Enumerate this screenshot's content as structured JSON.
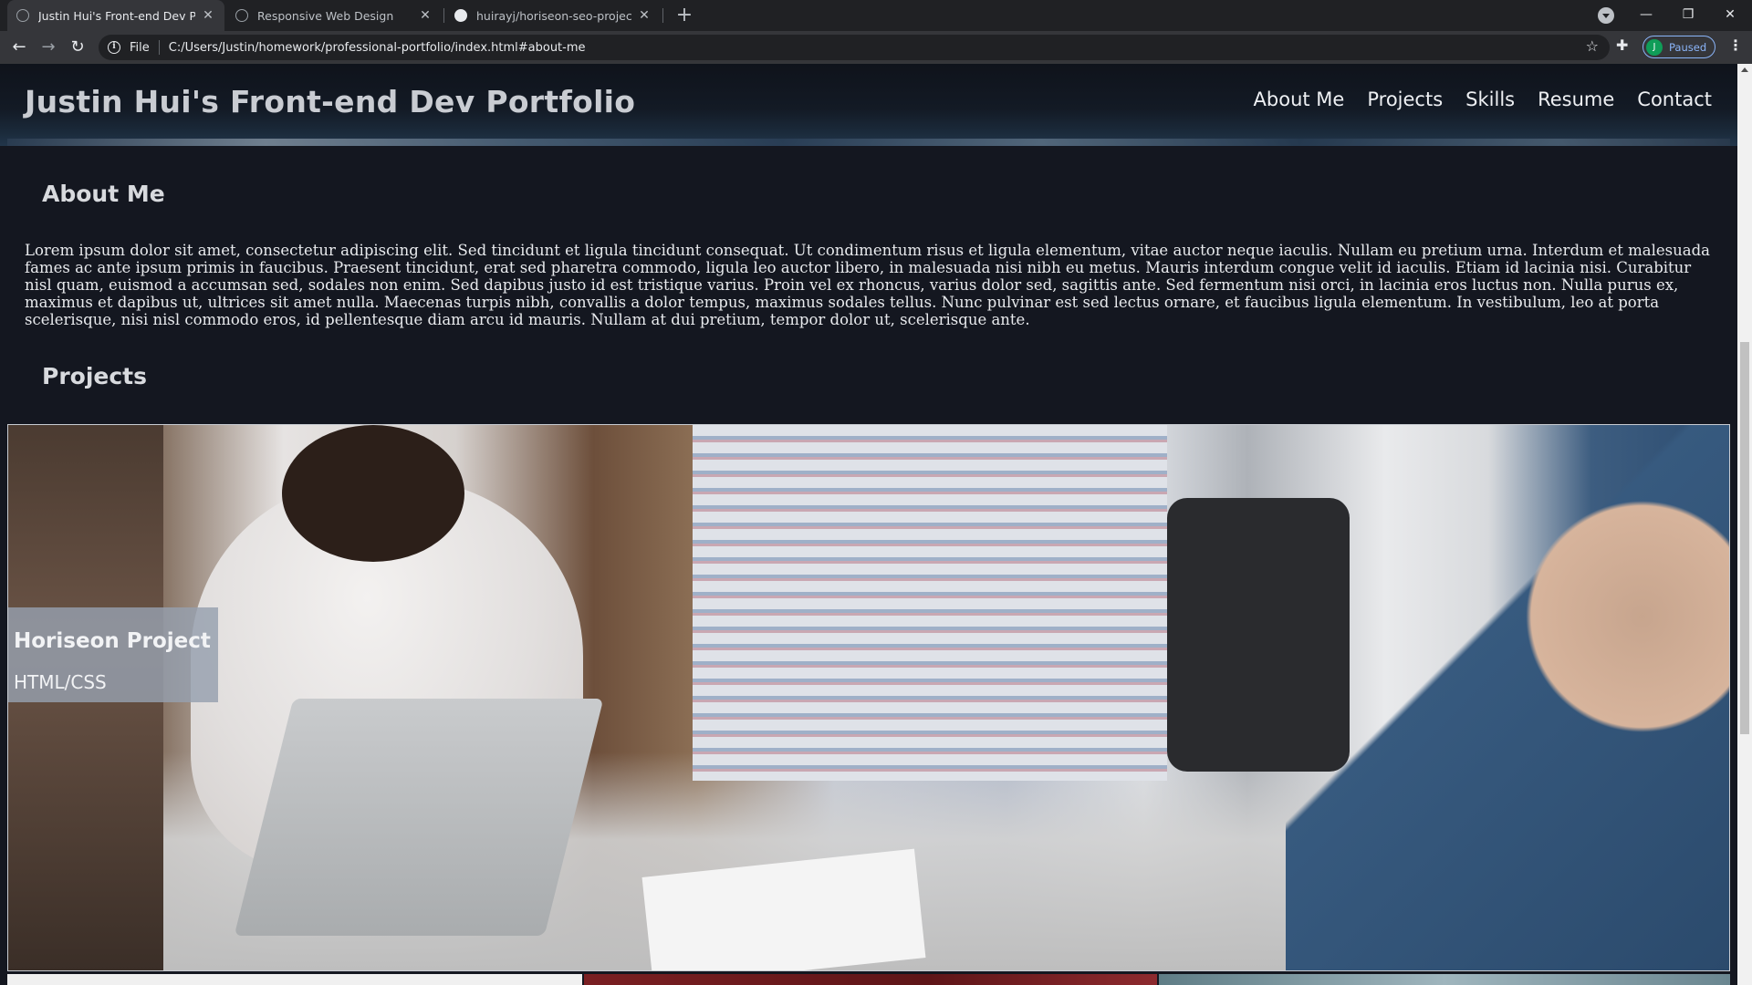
{
  "browser": {
    "tabs": [
      {
        "title": "Justin Hui's Front-end Dev Portfo",
        "active": true
      },
      {
        "title": "Responsive Web Design",
        "active": false
      },
      {
        "title": "huirayj/horiseon-seo-project: SE",
        "active": false
      }
    ],
    "address": {
      "scheme": "File",
      "url": "C:/Users/Justin/homework/professional-portfolio/index.html#about-me"
    },
    "profile": {
      "initial": "J",
      "status": "Paused"
    }
  },
  "site": {
    "title": "Justin Hui's Front-end Dev Portfolio",
    "nav": [
      "About Me",
      "Projects",
      "Skills",
      "Resume",
      "Contact"
    ]
  },
  "about": {
    "heading": "About Me",
    "text": "Lorem ipsum dolor sit amet, consectetur adipiscing elit. Sed tincidunt et ligula tincidunt consequat. Ut condimentum risus et ligula elementum, vitae auctor neque iaculis. Nullam eu pretium urna. Interdum et malesuada fames ac ante ipsum primis in faucibus. Praesent tincidunt, erat sed pharetra commodo, ligula leo auctor libero, in malesuada nisi nibh eu metus. Mauris interdum congue velit id iaculis. Etiam id lacinia nisi. Curabitur nisl quam, euismod a accumsan sed, sodales non enim. Sed dapibus justo id est tristique varius. Proin vel ex rhoncus, varius dolor sed, sagittis ante. Sed fermentum nisi orci, in lacinia eros luctus non. Nulla purus ex, maximus et dapibus ut, ultrices sit amet nulla. Maecenas turpis nibh, convallis a dolor tempus, maximus sodales tellus. Nunc pulvinar est sed lectus ornare, et faucibus ligula elementum. In vestibulum, leo at porta scelerisque, nisi nisl commodo eros, id pellentesque diam arcu id mauris. Nullam at dui pretium, tempor dolor ut, scelerisque ante."
  },
  "projects": {
    "heading": "Projects",
    "items": [
      {
        "name": "Horiseon Project",
        "tech": "HTML/CSS"
      }
    ]
  },
  "colors": {
    "page_bg": "#141720",
    "text": "#e8eaed",
    "chrome_dark": "#202124",
    "chrome_toolbar": "#35363a",
    "profile_accent": "#8ab4f8"
  }
}
